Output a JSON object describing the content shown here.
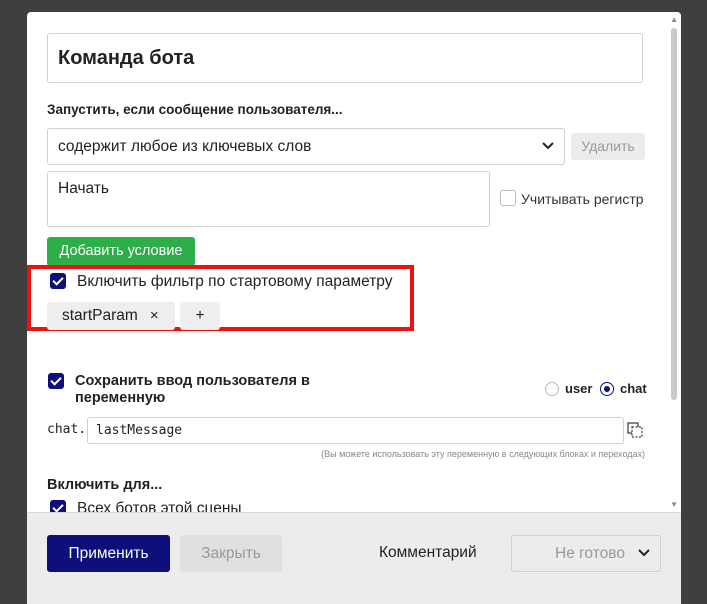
{
  "dialog": {
    "title": "Команда бота",
    "trigger_label": "Запустить, если сообщение пользователя...",
    "condition": {
      "selected": "содержит любое из ключевых слов",
      "delete_label": "Удалить",
      "keywords": "Начать",
      "case_sensitive_label": "Учитывать регистр",
      "case_sensitive": false
    },
    "add_condition_label": "Добавить условие",
    "start_param_filter": {
      "enabled": true,
      "label": "Включить фильтр по стартовому параметру",
      "chips": [
        "startParam"
      ],
      "chip_remove_glyph": "×",
      "add_glyph": "+"
    },
    "save_input": {
      "enabled": true,
      "label": "Сохранить ввод пользователя в переменную",
      "scope_options": [
        "user",
        "chat"
      ],
      "scope_selected": "chat",
      "prefix": "chat.",
      "variable_name": "lastMessage",
      "hint": "(Вы можете использовать эту переменную в следующих блоках и переходах)"
    },
    "include_for": {
      "label": "Включить для...",
      "all_bots_label": "Всех ботов этой сцены",
      "all_bots": true
    }
  },
  "footer": {
    "apply_label": "Применить",
    "close_label": "Закрыть",
    "comment_label": "Комментарий",
    "status_label": "Не готово"
  },
  "colors": {
    "primary": "#0d0f7a",
    "success": "#2eae48",
    "highlight": "#ee1111"
  }
}
